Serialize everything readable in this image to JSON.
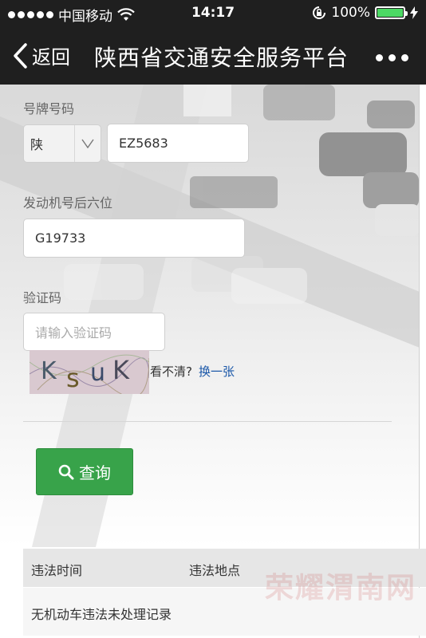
{
  "status_bar": {
    "carrier": "中国移动",
    "time": "14:17",
    "battery": "100%"
  },
  "nav": {
    "back_label": "返回",
    "title": "陕西省交通安全服务平台"
  },
  "form": {
    "plate_label": "号牌号码",
    "province_value": "陕",
    "plate_value": "EZ5683",
    "engine_label": "发动机号后六位",
    "engine_value": "G19733",
    "captcha_label": "验证码",
    "captcha_placeholder": "请输入验证码",
    "captcha_image_text": "KsuK",
    "captcha_hint": "看不清?",
    "captcha_refresh": "换一张",
    "submit_label": "查询"
  },
  "results": {
    "columns": [
      "违法时间",
      "违法地点"
    ],
    "empty_message": "无机动车违法未处理记录"
  },
  "watermark": "荣耀渭南网",
  "colors": {
    "nav_bg": "#1f1f1f",
    "button_green": "#38a34a",
    "link_blue": "#1a57a8",
    "battery_green": "#4cd964"
  }
}
